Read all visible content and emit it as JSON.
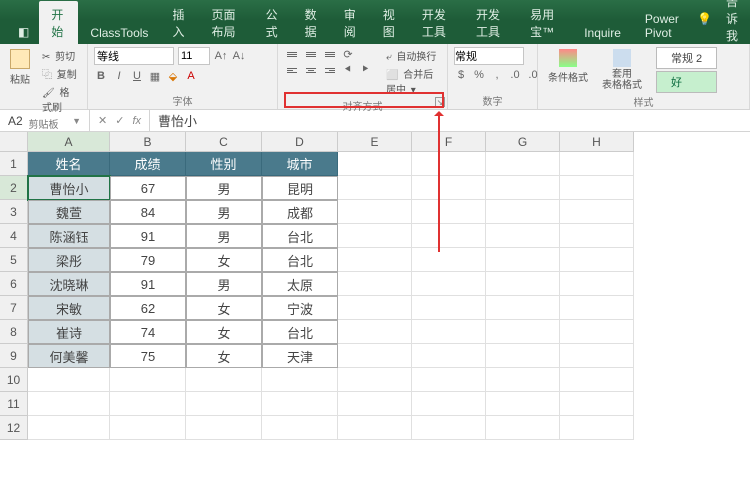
{
  "tabs": {
    "file_icon": "◧",
    "home": "开始",
    "classtools": "ClassTools",
    "insert": "插入",
    "layout": "页面布局",
    "formulas": "公式",
    "data": "数据",
    "review": "审阅",
    "view": "视图",
    "developer": "开发工具",
    "dev2": "开发工具",
    "addin": "易用宝™",
    "inquire": "Inquire",
    "powerpivot": "Power Pivot",
    "tell_me_icon": "💡",
    "tell_me": "告诉我"
  },
  "ribbon": {
    "clipboard": {
      "paste": "粘贴",
      "cut": "剪切",
      "copy": "复制",
      "painter": "格式刷",
      "label": "剪贴板"
    },
    "font": {
      "name": "等线",
      "size": "11",
      "label": "字体"
    },
    "align": {
      "wrap": "自动换行",
      "merge": "合并后居中",
      "label": "对齐方式"
    },
    "number": {
      "format": "常规",
      "label": "数字"
    },
    "styles": {
      "cond": "条件格式",
      "table": "套用\n表格格式",
      "normal": "常规 2",
      "good": "好",
      "label": "样式"
    }
  },
  "namebox": "A2",
  "formula": "曹怡小",
  "columns": [
    "A",
    "B",
    "C",
    "D",
    "E",
    "F",
    "G",
    "H"
  ],
  "rows": [
    "1",
    "2",
    "3",
    "4",
    "5",
    "6",
    "7",
    "8",
    "9",
    "10",
    "11",
    "12"
  ],
  "headers": {
    "name": "姓名",
    "score": "成绩",
    "gender": "性别",
    "city": "城市"
  },
  "chart_data": {
    "type": "table",
    "columns": [
      "姓名",
      "成绩",
      "性别",
      "城市"
    ],
    "records": [
      {
        "name": "曹怡小",
        "score": 67,
        "gender": "男",
        "city": "昆明"
      },
      {
        "name": "魏萱",
        "score": 84,
        "gender": "男",
        "city": "成都"
      },
      {
        "name": "陈涵钰",
        "score": 91,
        "gender": "男",
        "city": "台北"
      },
      {
        "name": "梁彤",
        "score": 79,
        "gender": "女",
        "city": "台北"
      },
      {
        "name": "沈晓琳",
        "score": 91,
        "gender": "男",
        "city": "太原"
      },
      {
        "name": "宋敏",
        "score": 62,
        "gender": "女",
        "city": "宁波"
      },
      {
        "name": "崔诗",
        "score": 74,
        "gender": "女",
        "city": "台北"
      },
      {
        "name": "何美馨",
        "score": 75,
        "gender": "女",
        "city": "天津"
      }
    ]
  },
  "active_cell": "A2"
}
